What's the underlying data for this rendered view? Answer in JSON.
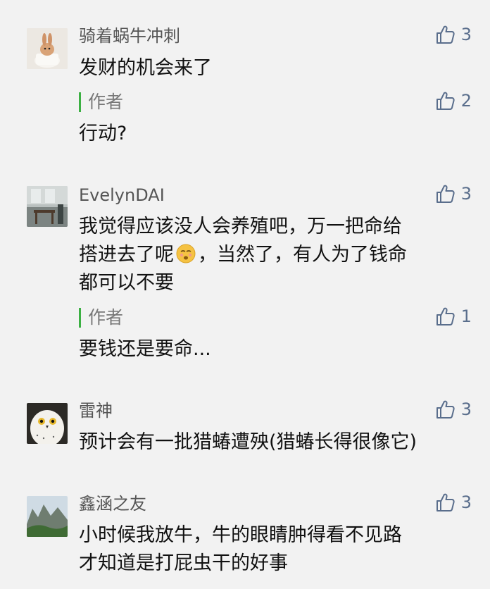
{
  "comments": [
    {
      "user": "骑着蜗牛冲刺",
      "likes": "3",
      "text": "发财的机会来了",
      "reply": {
        "author_label": "作者",
        "likes": "2",
        "text": "行动?"
      }
    },
    {
      "user": "EvelynDAI",
      "likes": "3",
      "text_lines": [
        "我觉得应该没人会养殖吧，万一把命给",
        "搭进去了呢",
        "，当然了，有人为了钱命",
        "都可以不要"
      ],
      "reply": {
        "author_label": "作者",
        "likes": "1",
        "text": "要钱还是要命..."
      }
    },
    {
      "user": "雷神",
      "likes": "3",
      "text": "预计会有一批猎蝽遭殃(猎蝽长得很像它)"
    },
    {
      "user": "鑫涵之友",
      "likes": "3",
      "text_lines": [
        "小时候我放牛，牛的眼睛肿得看不见路",
        "才知道是打屁虫干的好事"
      ]
    }
  ],
  "icons": {
    "like": "thumbs-up-icon",
    "emoji": "emoji-face-icon"
  }
}
